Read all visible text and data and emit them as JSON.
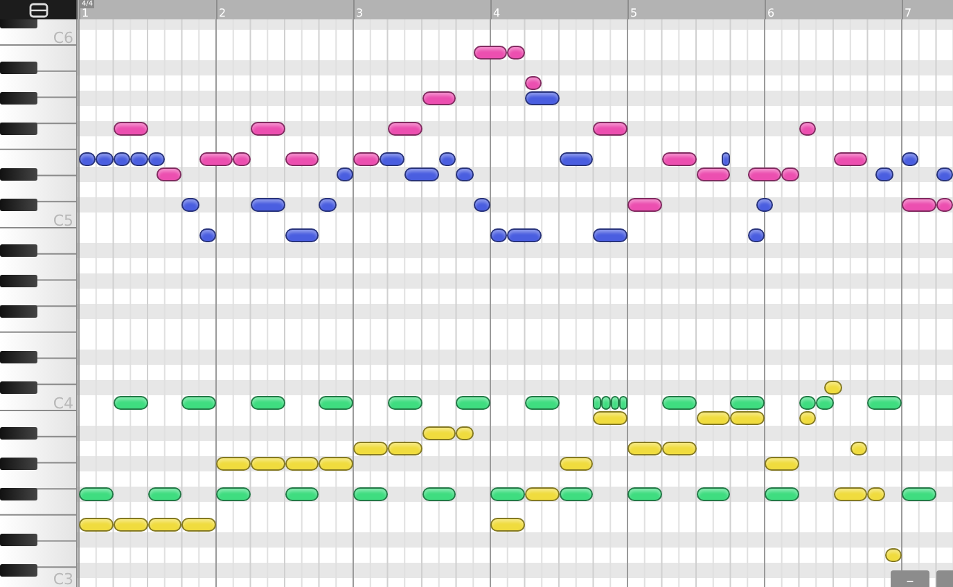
{
  "corner": {
    "kind": "menu"
  },
  "ruler": {
    "time_signature": "4/4",
    "bars": [
      "1",
      "2",
      "3",
      "4",
      "5",
      "6",
      "7"
    ]
  },
  "keyboard": {
    "labels": [
      "C6",
      "C5",
      "C4",
      "C3"
    ]
  },
  "tracks": [
    {
      "color": "#ec4fb0"
    },
    {
      "color": "#4a5ee0"
    },
    {
      "color": "#3fdd80"
    },
    {
      "color": "#f0dc3e"
    }
  ],
  "zoom_buttons": [
    {
      "kind": "minus",
      "label": "–"
    },
    {
      "kind": "cut"
    }
  ]
}
